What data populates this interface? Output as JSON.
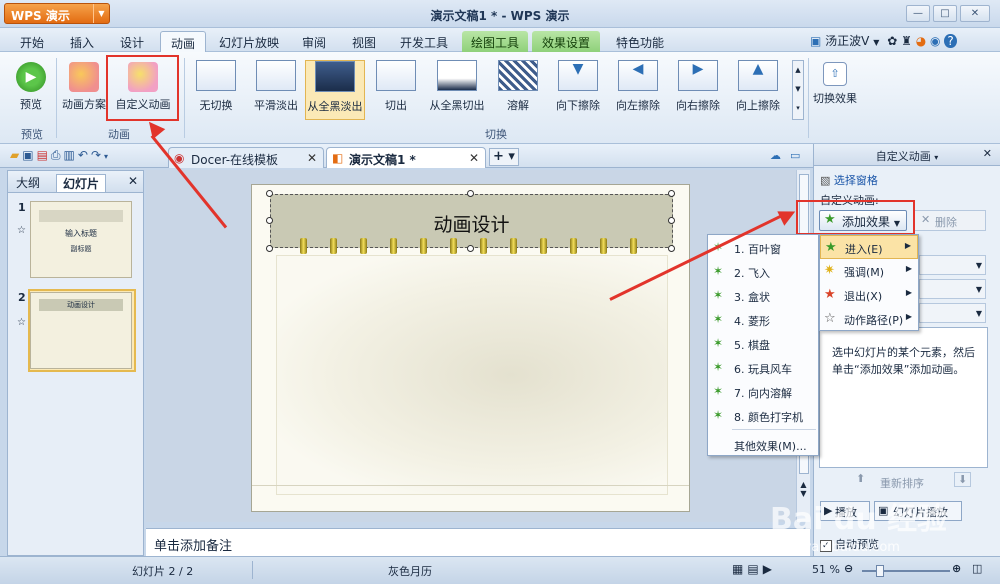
{
  "app": {
    "name": "WPS 演示",
    "window_title": "演示文稿1 * - WPS 演示"
  },
  "window_controls": {
    "minimize": "—",
    "maximize": "□",
    "close": "✕"
  },
  "menu": {
    "tabs": [
      "开始",
      "插入",
      "设计",
      "动画",
      "幻灯片放映",
      "审阅",
      "视图",
      "开发工具",
      "绘图工具",
      "效果设置",
      "特色功能"
    ],
    "active": "动画"
  },
  "user": {
    "name": "汤正波V"
  },
  "ribbon": {
    "preview_label": "预览",
    "scheme_label": "动画方案",
    "custom_anim_label": "自定义动画",
    "group_preview": "预览",
    "group_anim": "动画",
    "group_switch": "切换",
    "transitions": [
      "无切换",
      "平滑淡出",
      "从全黑淡出",
      "切出",
      "从全黑切出",
      "溶解",
      "向下擦除",
      "向左擦除",
      "向右擦除",
      "向上擦除"
    ],
    "selected_transition": "从全黑淡出",
    "switch_effect_label": "切换效果"
  },
  "doc_tabs": [
    {
      "label": "Docer-在线模板"
    },
    {
      "label": "演示文稿1 *"
    }
  ],
  "left_pane": {
    "tab_outline": "大纲",
    "tab_slides": "幻灯片",
    "slide1_num": "1",
    "slide1_title": "输入标题",
    "slide1_sub": "副标题",
    "slide2_num": "2",
    "slide2_title": "动画设计"
  },
  "slide": {
    "title": "动画设计"
  },
  "notes": {
    "placeholder": "单击添加备注"
  },
  "right_pane": {
    "title": "自定义动画",
    "select_pane": "选择窗格",
    "custom_label": "自定义动画:",
    "add_effect": "添加效果",
    "delete": "删除",
    "hint": "选中幻灯片的某个元素，然后单击“添加效果”添加动画。",
    "reorder": "重新排序",
    "play": "播放",
    "slideshow": "幻灯片播放",
    "autopreview": "自动预览"
  },
  "effects_menu": [
    "1. 百叶窗",
    "2. 飞入",
    "3. 盒状",
    "4. 菱形",
    "5. 棋盘",
    "6. 玩具风车",
    "7. 向内溶解",
    "8. 颜色打字机",
    "其他效果(M)..."
  ],
  "add_menu": [
    {
      "label": "进入(E)",
      "icon": "green-star"
    },
    {
      "label": "强调(M)",
      "icon": "yellow-star"
    },
    {
      "label": "退出(X)",
      "icon": "red-star"
    },
    {
      "label": "动作路径(P)",
      "icon": "outline-star"
    }
  ],
  "status": {
    "slide_count": "幻灯片 2 / 2",
    "theme": "灰色月历",
    "zoom": "51 %"
  },
  "watermark": {
    "text": "Bai du 经验",
    "url": "jingyan.baidu.com"
  },
  "colors": {
    "accent": "#e36c12",
    "highlight": "#e2342b"
  }
}
